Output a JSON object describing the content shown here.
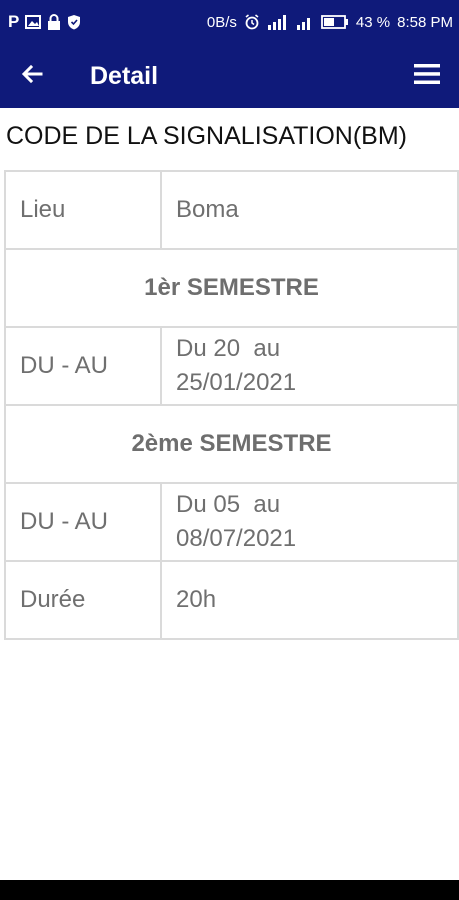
{
  "status_bar": {
    "left_icons": [
      "p-icon",
      "image-icon",
      "lock-icon",
      "shield-icon"
    ],
    "left_text": "P",
    "net_speed": "0B/s",
    "battery": "43 %",
    "time": "8:58 PM"
  },
  "app_bar": {
    "title": "Detail",
    "back_icon": "arrow-left-icon",
    "menu_icon": "hamburger-menu-icon"
  },
  "course": {
    "title": "CODE DE LA SIGNALISATION(BM)"
  },
  "details": {
    "lieu_label": "Lieu",
    "lieu_value": "Boma",
    "semester1_title": "1èr SEMESTRE",
    "semester1_label": "DU - AU",
    "semester1_line1": "Du 20  au",
    "semester1_line2": "25/01/2021",
    "semester2_title": "2ème SEMESTRE",
    "semester2_label": "DU - AU",
    "semester2_line1": "Du 05  au",
    "semester2_line2": "08/07/2021",
    "duree_label": "Durée",
    "duree_value": "20h"
  },
  "colors": {
    "primary": "#0f1a7a",
    "cell_text": "#6f6f6f",
    "border": "#dadada"
  }
}
